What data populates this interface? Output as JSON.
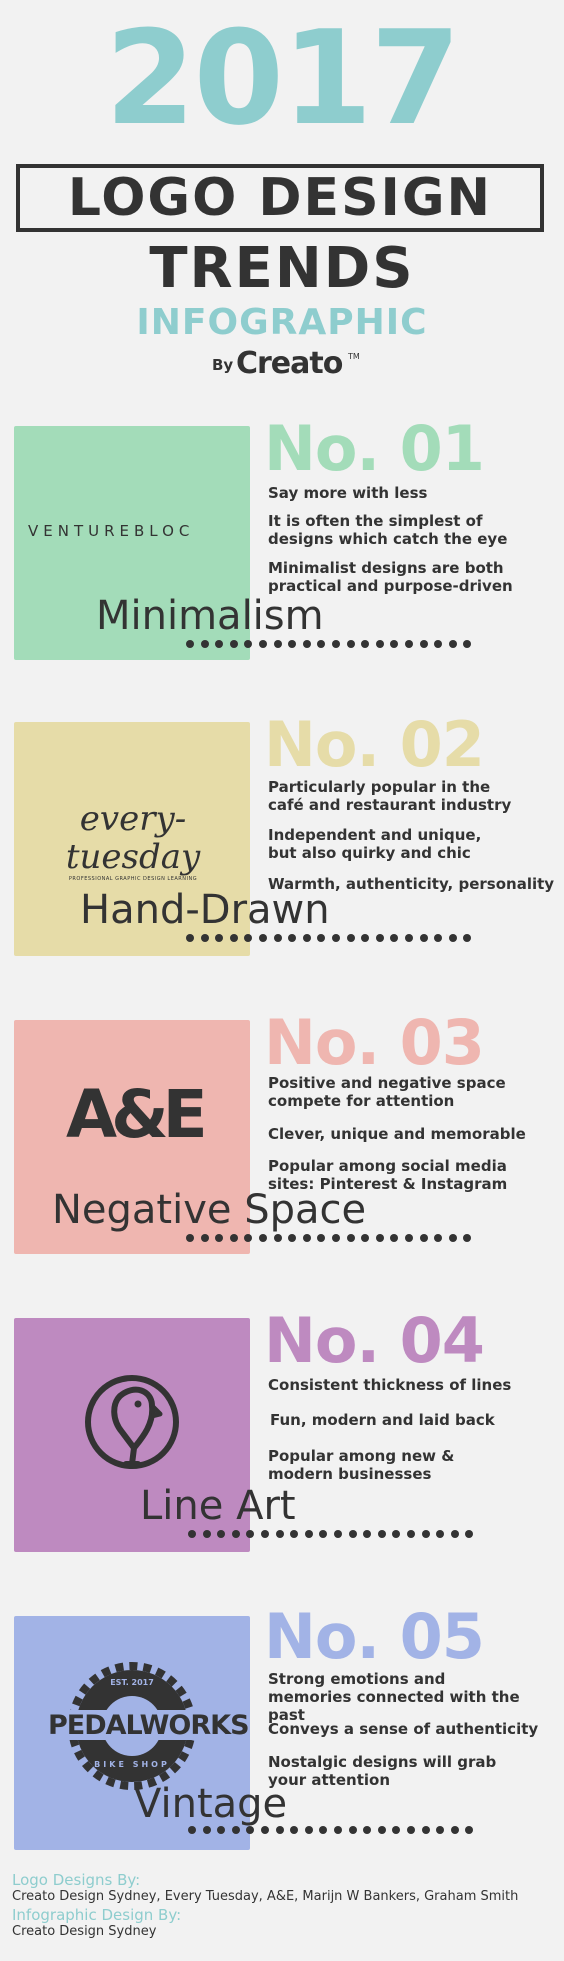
{
  "header": {
    "year": "2017",
    "title_box": "LOGO DESIGN",
    "line2": "TRENDS",
    "line3": "INFOGRAPHIC",
    "by": "By",
    "brand": "Creato",
    "tm": "TM"
  },
  "trends": [
    {
      "number": "No. 01",
      "color": "#a3dcb9",
      "num_color": "#a3dcb9",
      "logo_text": "VENTUREBLOC",
      "label": "Minimalism",
      "points": [
        "Say more with less",
        "It is often the simplest of designs which catch the eye",
        "Minimalist designs are both practical and purpose-driven"
      ]
    },
    {
      "number": "No. 02",
      "color": "#e6dca8",
      "num_color": "#e6dca8",
      "logo_text": "every-tuesday",
      "logo_sub": "PROFESSIONAL GRAPHIC DESIGN LEARNING",
      "label": "Hand-Drawn",
      "points": [
        "Particularly popular in the café and restaurant industry",
        "Independent and unique, but also quirky and chic",
        "Warmth, authenticity, personality"
      ]
    },
    {
      "number": "No. 03",
      "color": "#efb6b0",
      "num_color": "#efb6b0",
      "logo_text": "A&E",
      "label": "Negative Space",
      "points": [
        "Positive and negative space compete for attention",
        "Clever, unique and memorable",
        "Popular among social media sites: Pinterest & Instagram"
      ]
    },
    {
      "number": "No. 04",
      "color": "#be8ac0",
      "num_color": "#be8ac0",
      "logo_text": "",
      "label": "Line Art",
      "points": [
        "Consistent thickness of lines",
        "Fun, modern and laid back",
        "Popular among new & modern businesses"
      ]
    },
    {
      "number": "No. 05",
      "color": "#a2b3e6",
      "num_color": "#a2b3e6",
      "logo_text": "PEDALWORKS",
      "logo_top": "EST. 2017",
      "logo_bottom": "BIKE SHOP",
      "label": "Vintage",
      "points": [
        "Strong emotions and memories connected with the past",
        "Conveys a sense of authenticity",
        "Nostalgic designs will grab your attention"
      ]
    }
  ],
  "footer": {
    "logos_label": "Logo Designs By:",
    "logos_value": "Creato Design Sydney, Every Tuesday, A&E, Marijn W Bankers, Graham Smith",
    "design_label": "Infographic Design By:",
    "design_value": "Creato Design Sydney"
  }
}
